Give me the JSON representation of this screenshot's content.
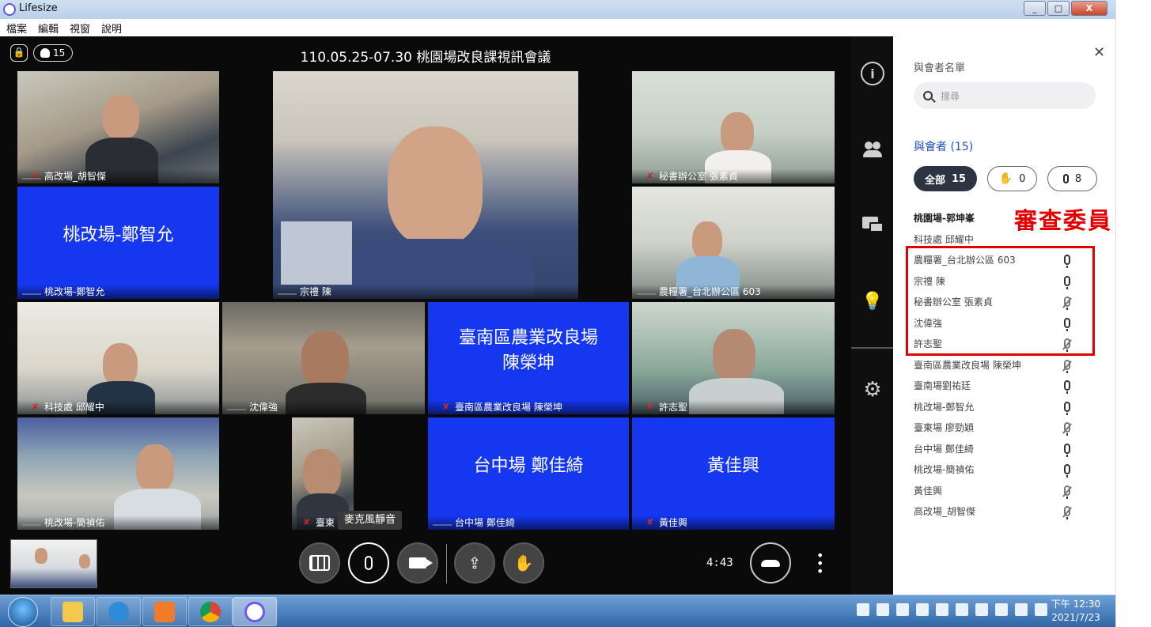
{
  "window": {
    "title": "Lifesize",
    "buttons": [
      "_",
      "□",
      "X"
    ]
  },
  "menubar": [
    "檔案",
    "編輯",
    "視窗",
    "說明"
  ],
  "meeting": {
    "title": "110.05.25-07.30 桃園場改良課視訊會議",
    "participant_count": "15",
    "timer": "4:43"
  },
  "tiles": [
    {
      "label": "高改場_胡智傑",
      "muted": true
    },
    {
      "label": "桃改場-鄭智允",
      "display_name": "桃改場-鄭智允",
      "muted": false
    },
    {
      "label": "宗禮 陳",
      "muted": false
    },
    {
      "label": "秘書辦公室 張素貞",
      "muted": true
    },
    {
      "label": "農糧署_台北辦公區 603",
      "muted": false
    },
    {
      "label": "科技處 邱耀中",
      "muted": true
    },
    {
      "label": "沈偉強",
      "muted": false
    },
    {
      "label": "臺南區農業改良場 陳榮坤",
      "display_name": "臺南區農業改良場\n陳榮坤",
      "muted": true
    },
    {
      "label": "許志聖",
      "muted": true
    },
    {
      "label": "桃改場-簡禎佑",
      "muted": false
    },
    {
      "label": "臺東",
      "muted": true
    },
    {
      "label": "台中場 鄭佳綺",
      "display_name": "台中場 鄭佳綺",
      "muted": false
    },
    {
      "label": "黃佳興",
      "display_name": "黃佳興",
      "muted": true
    }
  ],
  "controls": {
    "tooltip": "麥克風靜音"
  },
  "panel": {
    "title": "與會者名單",
    "search_placeholder": "搜尋",
    "attendees_header": "與會者 (15)",
    "filters": {
      "all_label": "全部",
      "all_count": "15",
      "hand_count": "0",
      "mic_count": "8"
    },
    "presenters": [
      "桃園場-郭坤峯",
      "科技處 邱耀中"
    ],
    "participants": [
      {
        "name": "農糧署_台北辦公區 603",
        "muted": false
      },
      {
        "name": "宗禮 陳",
        "muted": false
      },
      {
        "name": "秘書辦公室 張素貞",
        "muted": true
      },
      {
        "name": "沈偉強",
        "muted": false
      },
      {
        "name": "許志聖",
        "muted": true
      },
      {
        "name": "臺南區農業改良場 陳榮坤",
        "muted": true
      },
      {
        "name": "臺南場劉祐廷",
        "muted": false
      },
      {
        "name": "桃改場-鄭智允",
        "muted": false
      },
      {
        "name": "臺東場 廖勁穎",
        "muted": true
      },
      {
        "name": "台中場 鄭佳綺",
        "muted": false
      },
      {
        "name": "桃改場-簡禎佑",
        "muted": false
      },
      {
        "name": "黃佳興",
        "muted": true
      },
      {
        "name": "高改場_胡智傑",
        "muted": true
      }
    ]
  },
  "annotation": {
    "label": "審查委員",
    "color": "#e30000"
  },
  "taskbar": {
    "time": "下午 12:30",
    "date": "2021/7/23"
  }
}
